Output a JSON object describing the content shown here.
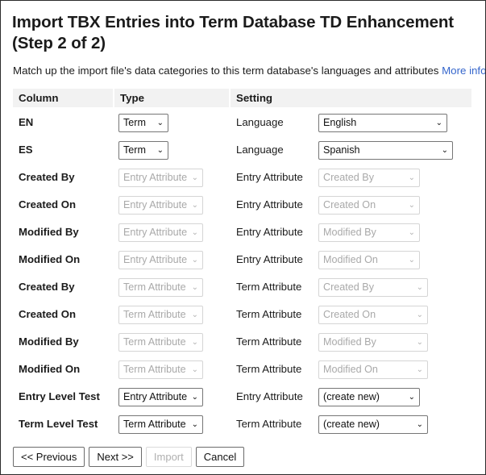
{
  "window": {
    "title": "Import TBX Entries into Term Database TD Enhancement (Step 2 of 2)"
  },
  "intro": {
    "text": "Match up the import file's data categories to this term database's languages and attributes ",
    "link_label": "More info...",
    "link_color": "#3566cc"
  },
  "table": {
    "headers": {
      "column": "Column",
      "type": "Type",
      "setting": "Setting"
    },
    "rows": [
      {
        "column": "EN",
        "type_value": "Term",
        "type_enabled": true,
        "type_width": 62,
        "setting_label": "Language",
        "setting_value": "English",
        "setting_enabled": true,
        "setting_width": 160
      },
      {
        "column": "ES",
        "type_value": "Term",
        "type_enabled": true,
        "type_width": 62,
        "setting_label": "Language",
        "setting_value": "Spanish",
        "setting_enabled": true,
        "setting_width": 167
      },
      {
        "column": "Created By",
        "type_value": "Entry Attribute",
        "type_enabled": false,
        "type_width": 105,
        "setting_label": "Entry Attribute",
        "setting_value": "Created By",
        "setting_enabled": false,
        "setting_width": 126
      },
      {
        "column": "Created On",
        "type_value": "Entry Attribute",
        "type_enabled": false,
        "type_width": 105,
        "setting_label": "Entry Attribute",
        "setting_value": "Created On",
        "setting_enabled": false,
        "setting_width": 126
      },
      {
        "column": "Modified By",
        "type_value": "Entry Attribute",
        "type_enabled": false,
        "type_width": 105,
        "setting_label": "Entry Attribute",
        "setting_value": "Modified By",
        "setting_enabled": false,
        "setting_width": 126
      },
      {
        "column": "Modified On",
        "type_value": "Entry Attribute",
        "type_enabled": false,
        "type_width": 105,
        "setting_label": "Entry Attribute",
        "setting_value": "Modified On",
        "setting_enabled": false,
        "setting_width": 126
      },
      {
        "column": "Created By",
        "type_value": "Term Attribute",
        "type_enabled": false,
        "type_width": 105,
        "setting_label": "Term Attribute",
        "setting_value": "Created By",
        "setting_enabled": false,
        "setting_width": 136
      },
      {
        "column": "Created On",
        "type_value": "Term Attribute",
        "type_enabled": false,
        "type_width": 105,
        "setting_label": "Term Attribute",
        "setting_value": "Created On",
        "setting_enabled": false,
        "setting_width": 136
      },
      {
        "column": "Modified By",
        "type_value": "Term Attribute",
        "type_enabled": false,
        "type_width": 105,
        "setting_label": "Term Attribute",
        "setting_value": "Modified By",
        "setting_enabled": false,
        "setting_width": 136
      },
      {
        "column": "Modified On",
        "type_value": "Term Attribute",
        "type_enabled": false,
        "type_width": 105,
        "setting_label": "Term Attribute",
        "setting_value": "Modified On",
        "setting_enabled": false,
        "setting_width": 136
      },
      {
        "column": "Entry Level Test",
        "type_value": "Entry Attribute",
        "type_enabled": true,
        "type_width": 105,
        "setting_label": "Entry Attribute",
        "setting_value": "(create new)",
        "setting_enabled": true,
        "setting_width": 126
      },
      {
        "column": "Term Level Test",
        "type_value": "Term Attribute",
        "type_enabled": true,
        "type_width": 105,
        "setting_label": "Term Attribute",
        "setting_value": "(create new)",
        "setting_enabled": true,
        "setting_width": 136
      }
    ]
  },
  "buttons": [
    {
      "label": "<< Previous",
      "enabled": true
    },
    {
      "label": "Next >>",
      "enabled": true
    },
    {
      "label": "Import",
      "enabled": false
    },
    {
      "label": "Cancel",
      "enabled": true
    }
  ],
  "icons": {
    "chevron_down": "chevron-down-icon",
    "chevron_glyph": "⌄"
  }
}
